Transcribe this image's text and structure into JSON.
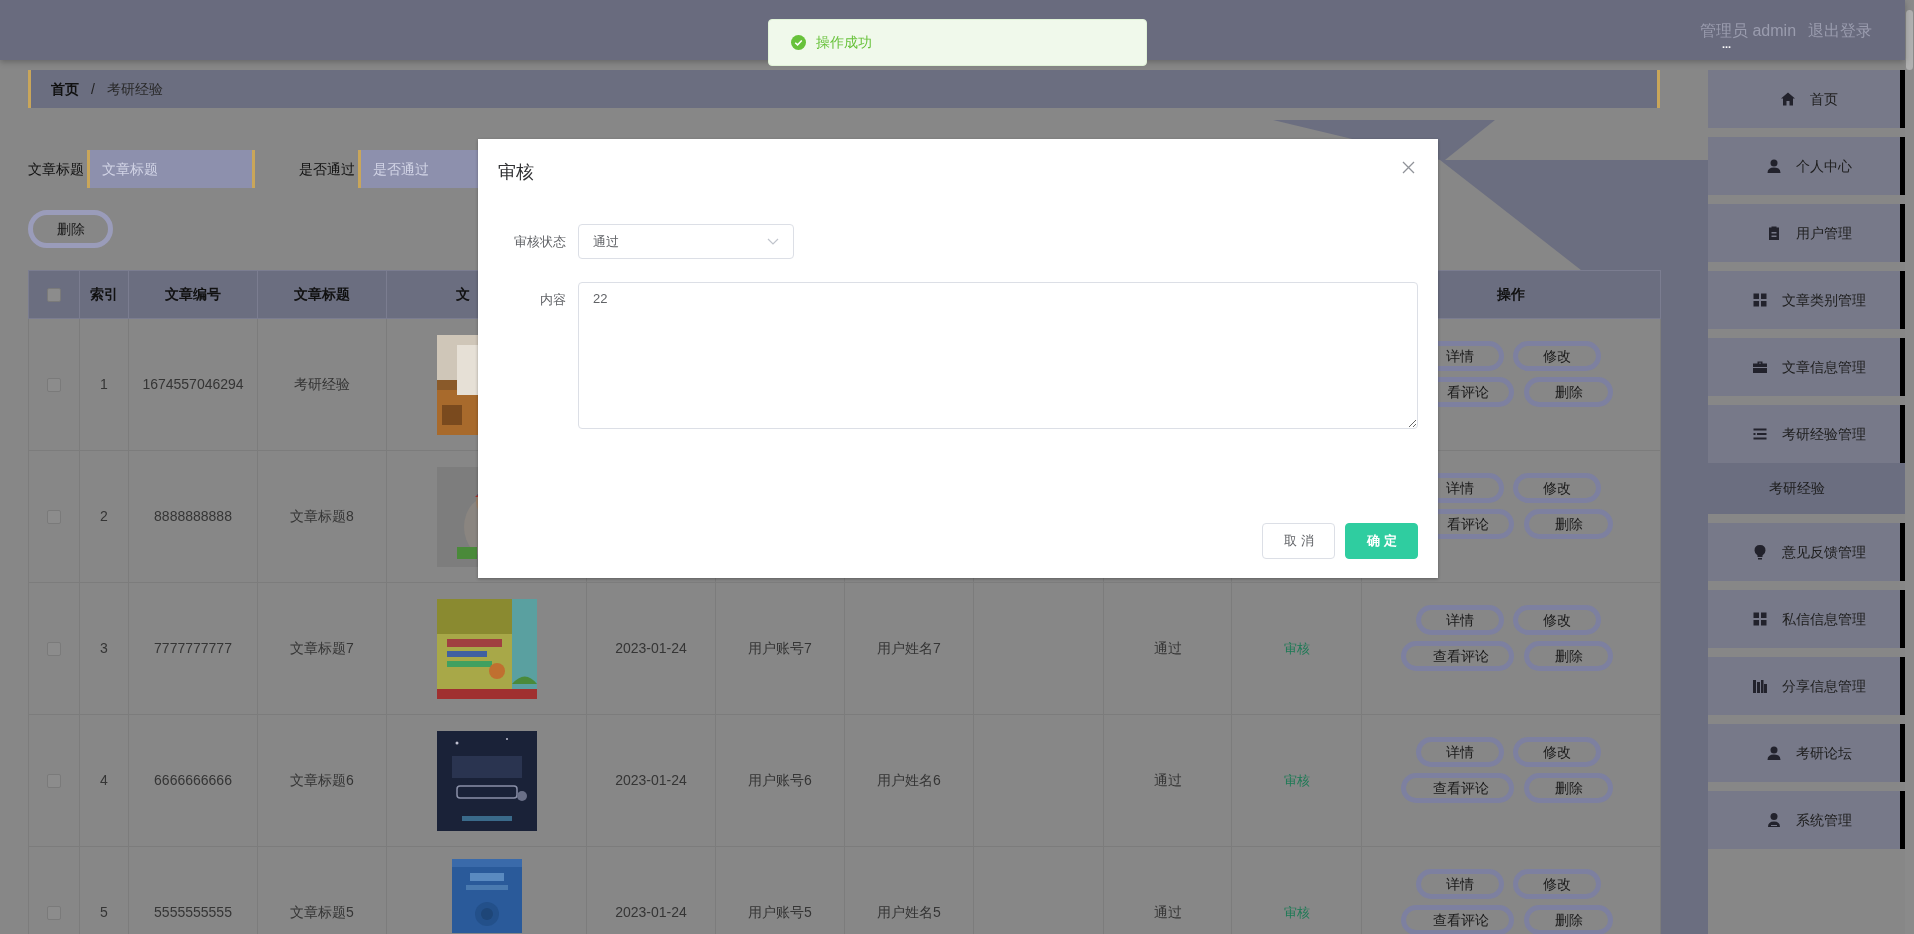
{
  "header": {
    "user_label": "管理员 admin",
    "logout": "退出登录",
    "more": "..."
  },
  "toast": {
    "message": "操作成功"
  },
  "breadcrumb": {
    "separator": "/",
    "items": [
      {
        "label": "首页",
        "bold": true
      },
      {
        "label": "考研经验",
        "bold": false
      }
    ]
  },
  "search": {
    "fields": [
      {
        "label": "文章标题",
        "placeholder": "文章标题"
      },
      {
        "label": "是否通过",
        "placeholder": "是否通过"
      }
    ]
  },
  "toolbar": {
    "delete_button": "删除"
  },
  "table": {
    "columns": [
      {
        "kind": "checkbox",
        "checked": false
      },
      {
        "kind": "text",
        "label": "索引"
      },
      {
        "kind": "text",
        "label": "文章编号"
      },
      {
        "kind": "text",
        "label": "文章标题"
      },
      {
        "kind": "text",
        "label": "文"
      },
      {
        "kind": "text",
        "label": "操作"
      }
    ],
    "rows": [
      {
        "checked": false,
        "index": "1",
        "number": "1674557046294",
        "title": "考研经验",
        "image": {
          "kind": "picture"
        },
        "actions": [
          "详情",
          "修改",
          "看评论",
          "删除"
        ]
      },
      {
        "checked": false,
        "index": "2",
        "number": "8888888888",
        "title": "文章标题8",
        "image": {
          "kind": "picture"
        },
        "actions": [
          "详情",
          "修改",
          "看评论",
          "删除"
        ]
      },
      {
        "checked": false,
        "index": "3",
        "number": "7777777777",
        "title": "文章标题7",
        "image": {
          "kind": "picture"
        },
        "date": "2023-01-24",
        "account": "用户账号7",
        "name": "用户姓名7",
        "passed": "通过",
        "review": "审核",
        "actions": [
          "详情",
          "修改",
          "查看评论",
          "删除"
        ]
      },
      {
        "checked": false,
        "index": "4",
        "number": "6666666666",
        "title": "文章标题6",
        "image": {
          "kind": "picture"
        },
        "date": "2023-01-24",
        "account": "用户账号6",
        "name": "用户姓名6",
        "passed": "通过",
        "review": "审核",
        "actions": [
          "详情",
          "修改",
          "查看评论",
          "删除"
        ]
      },
      {
        "checked": false,
        "index": "5",
        "number": "5555555555",
        "title": "文章标题5",
        "image": {
          "kind": "picture"
        },
        "date": "2023-01-24",
        "account": "用户账号5",
        "name": "用户姓名5",
        "passed": "通过",
        "review": "审核",
        "actions": [
          "详情",
          "修改",
          "查看评论",
          "删除"
        ]
      }
    ]
  },
  "sidebar": {
    "items": [
      {
        "label": "首页",
        "selected": false
      },
      {
        "label": "个人中心",
        "selected": false
      },
      {
        "label": "用户管理",
        "selected": false
      },
      {
        "label": "文章类别管理",
        "selected": false
      },
      {
        "label": "文章信息管理",
        "selected": false
      },
      {
        "label": "考研经验管理",
        "selected": false,
        "expanded": true,
        "children": [
          {
            "label": "考研经验",
            "selected": true
          }
        ]
      },
      {
        "label": "意见反馈管理",
        "selected": false
      },
      {
        "label": "私信信息管理",
        "selected": false
      },
      {
        "label": "分享信息管理",
        "selected": false
      },
      {
        "label": "考研论坛",
        "selected": false
      },
      {
        "label": "系统管理",
        "selected": false
      }
    ]
  },
  "dialog": {
    "title": "审核",
    "fields": [
      {
        "kind": "select",
        "label": "审核状态",
        "value": "通过"
      },
      {
        "kind": "textarea",
        "label": "内容",
        "value": "22"
      }
    ],
    "buttons": [
      {
        "kind": "secondary",
        "label": "取消"
      },
      {
        "kind": "primary",
        "label": "确定"
      }
    ]
  }
}
